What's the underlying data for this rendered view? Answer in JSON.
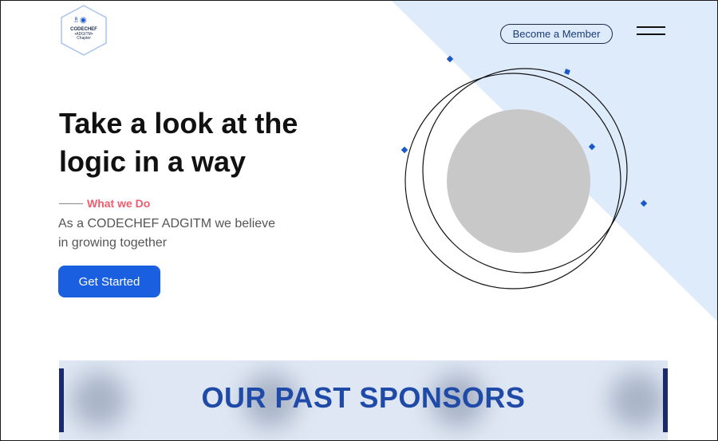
{
  "logo": {
    "name": "CODECHEF",
    "sub": "•ADGITM•",
    "chapter": "Chapter",
    "icon": "codechef-logo-icon"
  },
  "nav": {
    "member_button": "Become a Member",
    "menu_icon": "hamburger-menu-icon"
  },
  "hero": {
    "title_line1": "Take a look at the",
    "title_line2": "logic in a way",
    "subhead": "What we Do",
    "desc_line1": "As a CODECHEF ADGITM we believe",
    "desc_line2": "in growing together",
    "cta": "Get Started"
  },
  "sponsors": {
    "title": "OUR PAST SPONSORS"
  },
  "colors": {
    "accent_blue": "#1a5fe0",
    "diagonal_bg": "#deebfb",
    "subhead_pink": "#f25c6e",
    "sponsor_title": "#1f4aa8"
  }
}
